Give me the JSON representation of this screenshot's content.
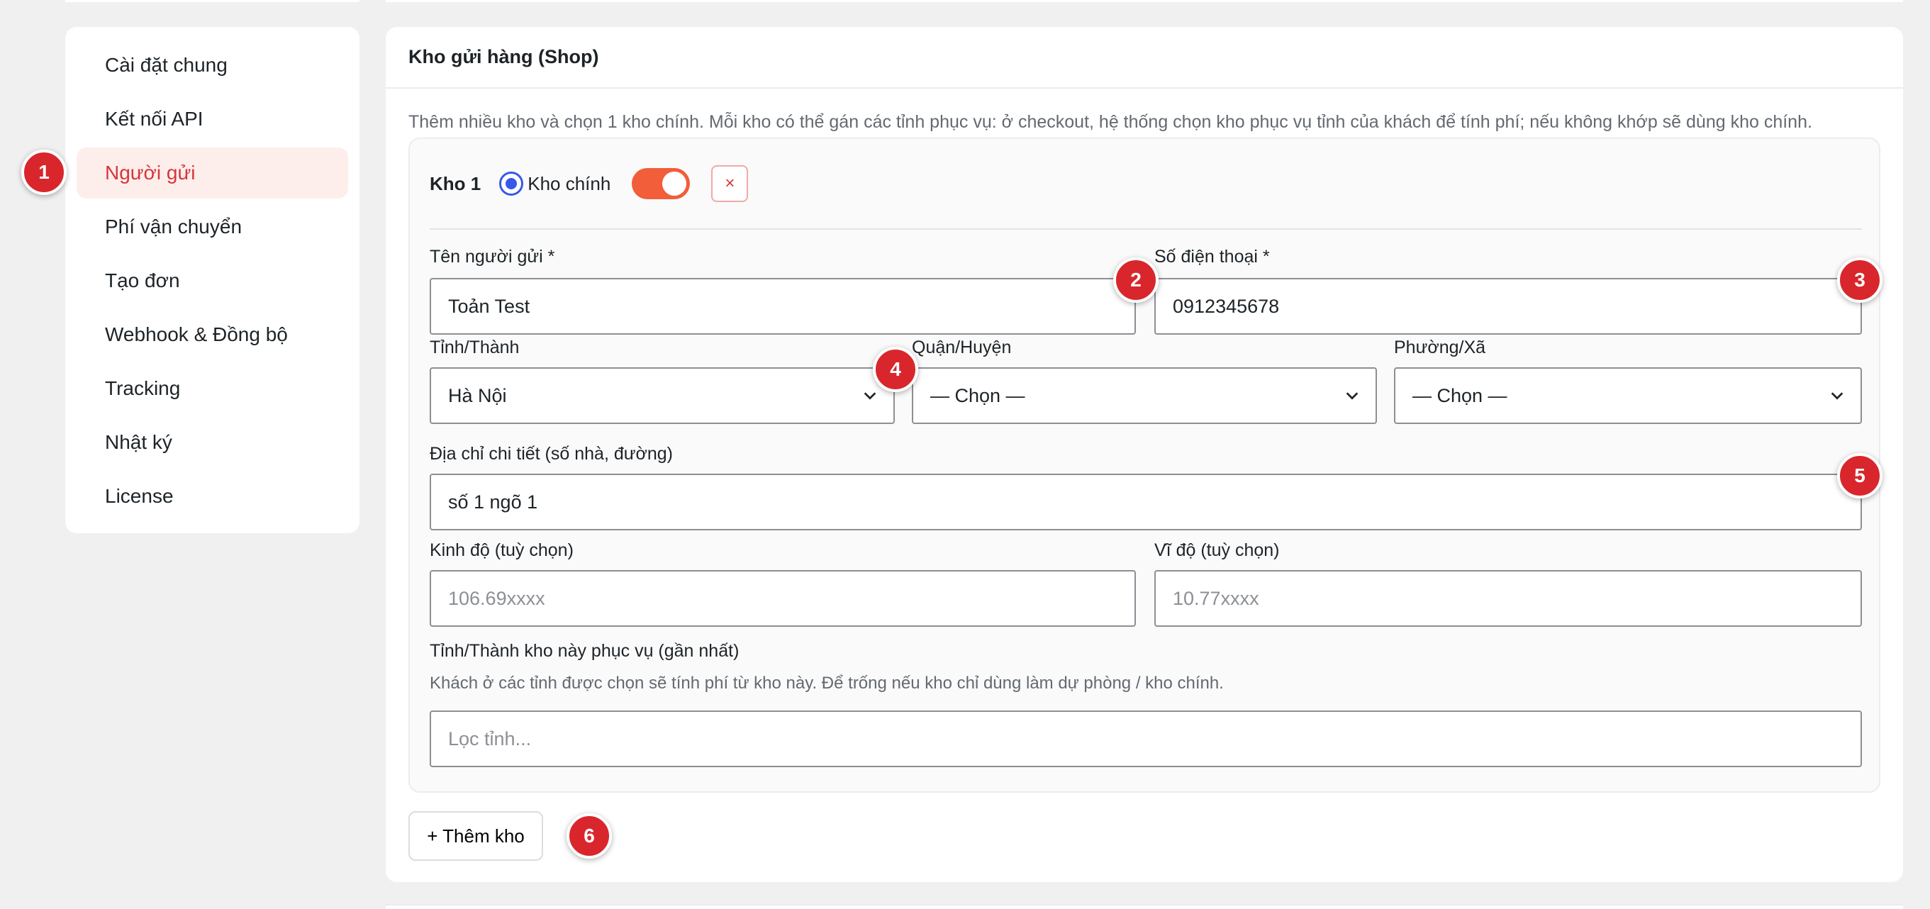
{
  "sidebar": {
    "items": [
      {
        "label": "Cài đặt chung"
      },
      {
        "label": "Kết nối API"
      },
      {
        "label": "Người gửi"
      },
      {
        "label": "Phí vận chuyển"
      },
      {
        "label": "Tạo đơn"
      },
      {
        "label": "Webhook & Đồng bộ"
      },
      {
        "label": "Tracking"
      },
      {
        "label": "Nhật ký"
      },
      {
        "label": "License"
      }
    ]
  },
  "card": {
    "title": "Kho gửi hàng (Shop)",
    "description": "Thêm nhiều kho và chọn 1 kho chính. Mỗi kho có thể gán các tỉnh phục vụ: ở checkout, hệ thống chọn kho phục vụ tỉnh của khách để tính phí; nếu không khớp sẽ dùng kho chính."
  },
  "warehouse": {
    "title": "Kho 1",
    "primary_label": "Kho chính",
    "remove_icon": "×",
    "sender_name": {
      "label": "Tên người gửi *",
      "value": "Toản Test"
    },
    "phone": {
      "label": "Số điện thoại *",
      "value": "0912345678"
    },
    "province": {
      "label": "Tỉnh/Thành",
      "value": "Hà Nội"
    },
    "district": {
      "label": "Quận/Huyện",
      "value": "— Chọn —"
    },
    "ward": {
      "label": "Phường/Xã",
      "value": "— Chọn —"
    },
    "address": {
      "label": "Địa chỉ chi tiết (số nhà, đường)",
      "value": "số 1 ngõ 1"
    },
    "longitude": {
      "label": "Kinh độ (tuỳ chọn)",
      "placeholder": "106.69xxxx"
    },
    "latitude": {
      "label": "Vĩ độ (tuỳ chọn)",
      "placeholder": "10.77xxxx"
    },
    "served_provinces": {
      "label": "Tỉnh/Thành kho này phục vụ (gần nhất)",
      "hint": "Khách ở các tỉnh được chọn sẽ tính phí từ kho này. Để trống nếu kho chỉ dùng làm dự phòng / kho chính.",
      "placeholder": "Lọc tỉnh..."
    }
  },
  "add_warehouse_label": "+ Thêm kho",
  "markers": [
    "1",
    "2",
    "3",
    "4",
    "5",
    "6"
  ],
  "colors": {
    "accent": "#d63638",
    "toggle_on": "#f25d3a",
    "radio": "#3858e9",
    "marker": "#d9262c"
  }
}
